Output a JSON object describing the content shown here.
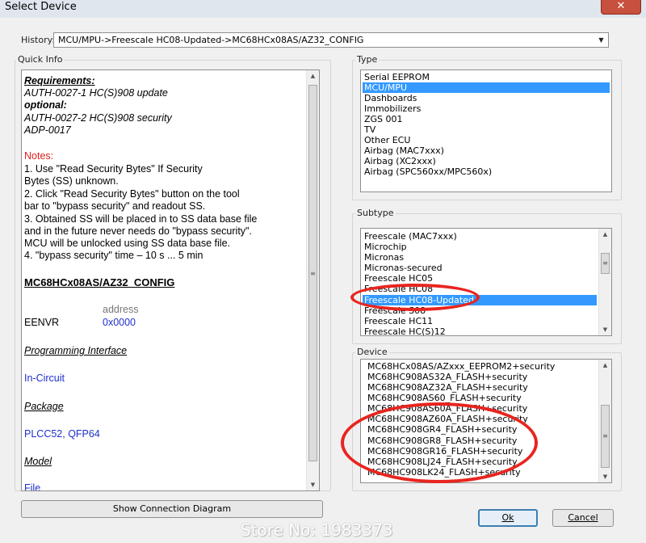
{
  "window": {
    "title": "Select Device",
    "close_glyph": "✕"
  },
  "history": {
    "label": "History:",
    "value": "MCU/MPU->Freescale HC08-Updated->MC68HCx08AS/AZ32_CONFIG"
  },
  "quick_info": {
    "label": "Quick Info",
    "requirements_title": "Requirements:",
    "req_line1": "AUTH-0027-1 HC(S)908  update",
    "optional_title": "optional:",
    "opt_line1": "AUTH-0027-2 HC(S)908  security",
    "opt_line2": "ADP-0017",
    "notes_title": "Notes:",
    "notes": [
      "1. Use \"Read Security Bytes\" If Security",
      "Bytes (SS) unknown.",
      "2. Click \"Read Security Bytes\" button on the tool",
      "bar to \"bypass security\" and readout SS.",
      "3. Obtained SS will be placed in to SS data base file",
      "and in the future never needs do \"bypass security\".",
      "MCU will be unlocked using SS data base file.",
      "4. \"bypass security\" time – 10 s ... 5 min"
    ],
    "config_name": "MC68HCx08AS/AZ32_CONFIG",
    "address_header": "address",
    "register_name": "EENVR",
    "register_address": "0x0000",
    "programming_interface_title": "Programming Interface",
    "programming_interface_value": "In-Circuit",
    "package_title": "Package",
    "package_value": "PLCC52, QFP64",
    "model_title": "Model",
    "file_title": "File"
  },
  "type": {
    "label": "Type",
    "items": [
      "Serial EEPROM",
      "MCU/MPU",
      "Dashboards",
      "Immobilizers",
      "ZGS 001",
      "TV",
      "Other ECU",
      "Airbag (MAC7xxx)",
      "Airbag (XC2xxx)",
      "Airbag (SPC560xx/MPC560x)"
    ],
    "selected_index": 1
  },
  "subtype": {
    "label": "Subtype",
    "items": [
      "Freescale (MAC7xxx)",
      "Microchip",
      "Micronas",
      "Micronas-secured",
      "Freescale HC05",
      "Freescale HC08",
      "Freescale HC08-Updated",
      "Freescale S08",
      "Freescale HC11",
      "Freescale HC(S)12"
    ],
    "selected_index": 6
  },
  "device": {
    "label": "Device",
    "items": [
      "MC68HCx08AS/AZxxx_EEPROM2+security",
      "MC68HC908AS32A_FLASH+security",
      "MC68HC908AZ32A_FLASH+security",
      "MC68HC908AS60_FLASH+security",
      "MC68HC908AS60A_FLASH+security",
      "MC68HC908AZ60A_FLASH+security",
      "MC68HC908GR4_FLASH+security",
      "MC68HC908GR8_FLASH+security",
      "MC68HC908GR16_FLASH+security",
      "MC68HC908LJ24_FLASH+security",
      "MC68HC908LK24_FLASH+security"
    ]
  },
  "buttons": {
    "show_connection": "Show Connection Diagram",
    "ok": "Ok",
    "cancel": "Cancel"
  },
  "watermark": "Store No: 1983373",
  "colors": {
    "selection": "#3399ff",
    "annotation_circle": "#e8251f",
    "notes_red": "#e02020",
    "link_blue": "#1f2fcf"
  }
}
